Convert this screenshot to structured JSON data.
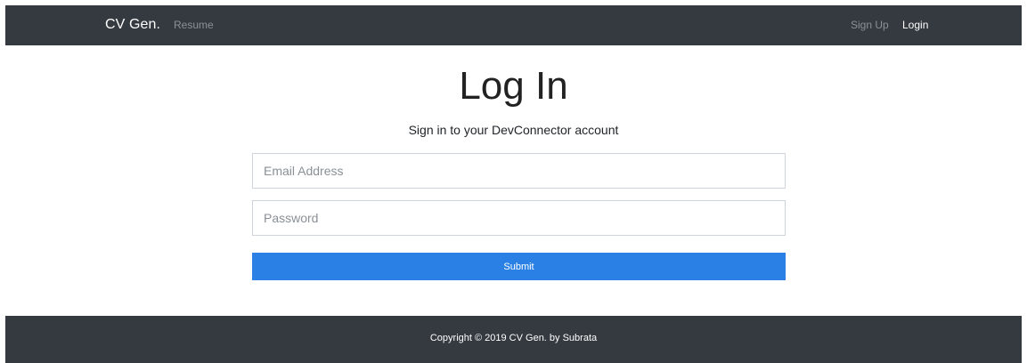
{
  "navbar": {
    "brand": "CV Gen.",
    "links": {
      "resume": "Resume",
      "sign_up": "Sign Up",
      "login": "Login"
    }
  },
  "main": {
    "title": "Log In",
    "subtitle": "Sign in to your DevConnector account",
    "email": {
      "placeholder": "Email Address",
      "value": ""
    },
    "password": {
      "placeholder": "Password",
      "value": ""
    },
    "submit_label": "Submit"
  },
  "footer": {
    "copyright": "Copyright © 2019 CV Gen. by Subrata"
  },
  "colors": {
    "navbar_bg": "#343a40",
    "submit_bg": "#2a80e4",
    "muted_link": "#8c9196"
  }
}
